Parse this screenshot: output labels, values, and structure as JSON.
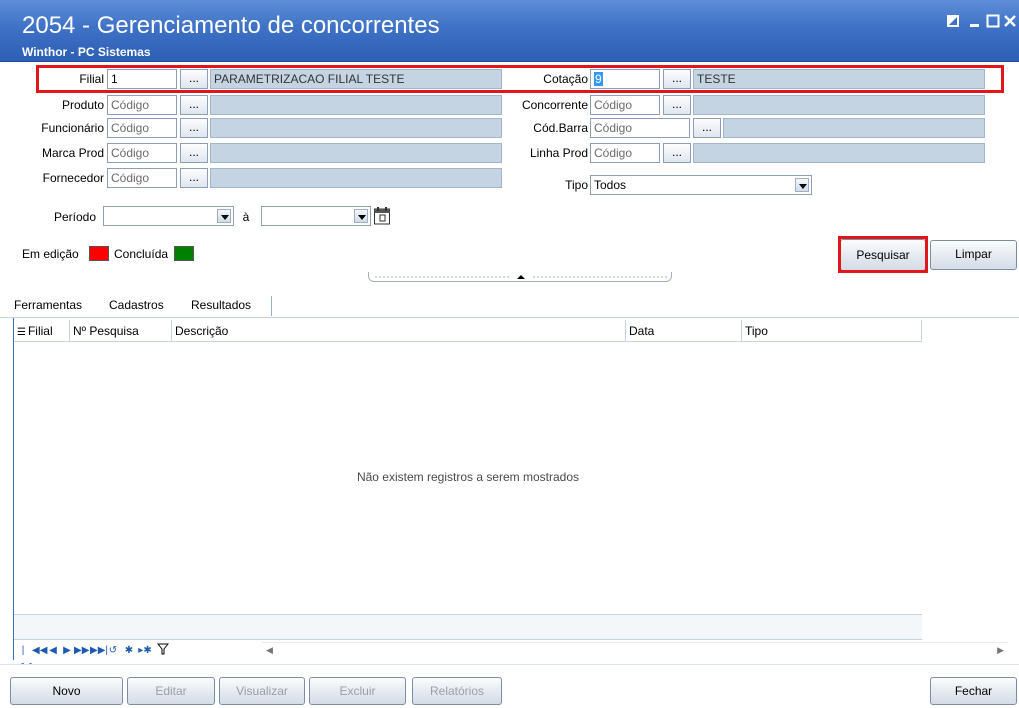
{
  "window": {
    "title": "2054 - Gerenciamento de concorrentes",
    "subtitle": "Winthor - PC Sistemas"
  },
  "filters": {
    "filial": {
      "label": "Filial",
      "value": "1",
      "button": "...",
      "desc": "PARAMETRIZACAO FILIAL TESTE"
    },
    "produto": {
      "label": "Produto",
      "placeholder": "Código",
      "button": "...",
      "desc": ""
    },
    "funcionario": {
      "label": "Funcionário",
      "placeholder": "Código",
      "button": "...",
      "desc": ""
    },
    "marca_prod": {
      "label": "Marca Prod",
      "placeholder": "Código",
      "button": "...",
      "desc": ""
    },
    "fornecedor": {
      "label": "Fornecedor",
      "placeholder": "Código",
      "button": "...",
      "desc": ""
    },
    "cotacao": {
      "label": "Cotação",
      "value": "9",
      "button": "...",
      "desc": "TESTE"
    },
    "concorrente": {
      "label": "Concorrente",
      "placeholder": "Código",
      "button": "...",
      "desc": ""
    },
    "cod_barra": {
      "label": "Cód.Barra",
      "placeholder": "Código",
      "button": "...",
      "desc": ""
    },
    "linha_prod": {
      "label": "Linha Prod",
      "placeholder": "Código",
      "button": "...",
      "desc": ""
    },
    "tipo": {
      "label": "Tipo",
      "selected": "Todos"
    },
    "periodo": {
      "label": "Período",
      "separator": "à",
      "start": "",
      "end": ""
    }
  },
  "legend": {
    "em_edicao": {
      "label": "Em edição",
      "color": "#ff0000"
    },
    "concluida": {
      "label": "Concluída",
      "color": "#008000"
    }
  },
  "actions": {
    "pesquisar": "Pesquisar",
    "limpar": "Limpar"
  },
  "tabs": [
    "Ferramentas",
    "Cadastros",
    "Resultados"
  ],
  "grid": {
    "columns": [
      "Filial",
      "Nº Pesquisa",
      "Descrição",
      "Data",
      "Tipo"
    ],
    "empty_message": "Não existem registros a serem mostrados"
  },
  "bottom_buttons": {
    "novo": "Novo",
    "editar": "Editar",
    "visualizar": "Visualizar",
    "excluir": "Excluir",
    "relatorios": "Relatórios",
    "fechar": "Fechar"
  },
  "colors": {
    "titlebar": "#3f72c6",
    "highlight": "#e0161b",
    "desc_box": "#c5d4e3"
  }
}
